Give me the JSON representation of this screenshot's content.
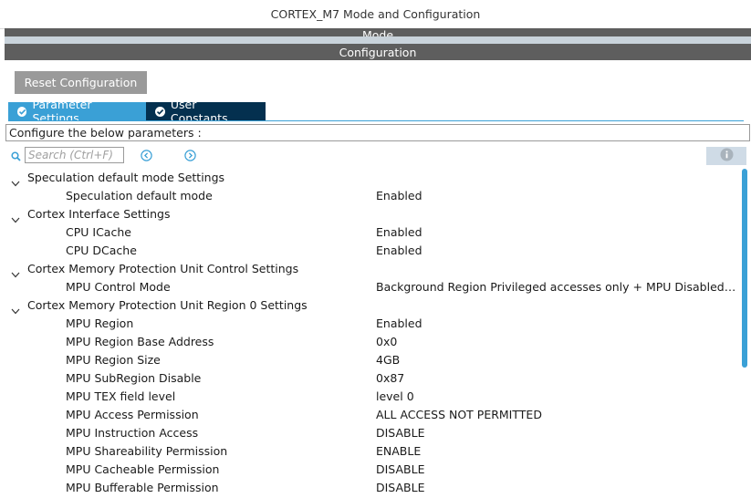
{
  "window": {
    "title": "CORTEX_M7 Mode and Configuration"
  },
  "sections": {
    "mode_label": "Mode",
    "config_label": "Configuration"
  },
  "toolbar": {
    "reset_label": "Reset Configuration"
  },
  "tabs": [
    {
      "label": "Parameter Settings",
      "active": true,
      "icon": "check-circle-icon"
    },
    {
      "label": "User Constants",
      "active": false,
      "icon": "check-circle-icon"
    }
  ],
  "description": "Configure the below parameters :",
  "search": {
    "placeholder": "Search (Ctrl+F)",
    "value": ""
  },
  "colors": {
    "tab_active": "#3aa0d6",
    "tab_inactive": "#04304f",
    "section_bar": "#5e5e5e",
    "reset_button": "#9a9a9a",
    "scrollbar": "#3aa0d6"
  },
  "tree": [
    {
      "group": "Speculation default mode Settings",
      "items": [
        {
          "name": "Speculation default mode",
          "value": "Enabled"
        }
      ]
    },
    {
      "group": "Cortex Interface Settings",
      "items": [
        {
          "name": "CPU ICache",
          "value": "Enabled"
        },
        {
          "name": "CPU DCache",
          "value": "Enabled"
        }
      ]
    },
    {
      "group": "Cortex Memory Protection Unit Control Settings",
      "items": [
        {
          "name": "MPU Control Mode",
          "value": "Background Region Privileged accesses only + MPU Disabled duri..."
        }
      ]
    },
    {
      "group": "Cortex Memory Protection Unit Region 0 Settings",
      "items": [
        {
          "name": "MPU Region",
          "value": "Enabled"
        },
        {
          "name": "MPU Region Base Address",
          "value": "0x0"
        },
        {
          "name": "MPU Region Size",
          "value": "4GB"
        },
        {
          "name": "MPU SubRegion Disable",
          "value": "0x87"
        },
        {
          "name": "MPU TEX field level",
          "value": "level 0"
        },
        {
          "name": "MPU Access Permission",
          "value": "ALL ACCESS NOT PERMITTED"
        },
        {
          "name": "MPU Instruction Access",
          "value": "DISABLE"
        },
        {
          "name": "MPU Shareability Permission",
          "value": "ENABLE"
        },
        {
          "name": "MPU Cacheable Permission",
          "value": "DISABLE"
        },
        {
          "name": "MPU Bufferable  Permission",
          "value": "DISABLE"
        }
      ]
    }
  ]
}
